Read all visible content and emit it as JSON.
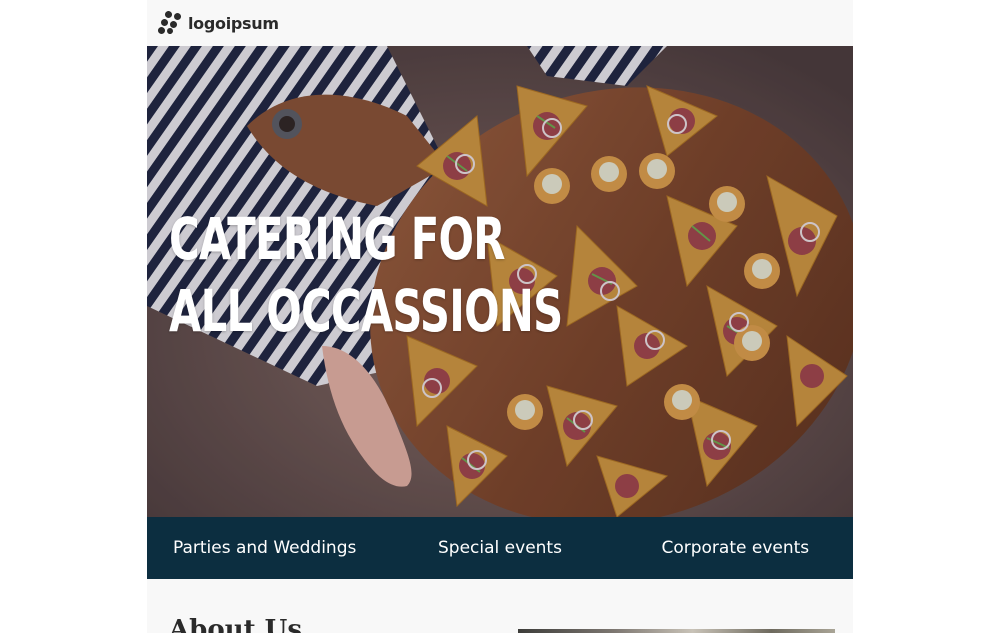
{
  "header": {
    "logo_text": "logoipsum",
    "logo_icon": "logo-mark-icon"
  },
  "hero": {
    "title_line1": "CATERING FOR",
    "title_line2": "ALL OCCASSIONS",
    "image": "catering-board-photo"
  },
  "nav": {
    "items": [
      {
        "label": "Parties and Weddings"
      },
      {
        "label": "Special events"
      },
      {
        "label": "Corporate events"
      }
    ]
  },
  "about": {
    "heading": "About Us"
  },
  "colors": {
    "nav_background": "#0c2e40",
    "page_background": "#f8f8f8",
    "hero_text": "#ffffff"
  }
}
